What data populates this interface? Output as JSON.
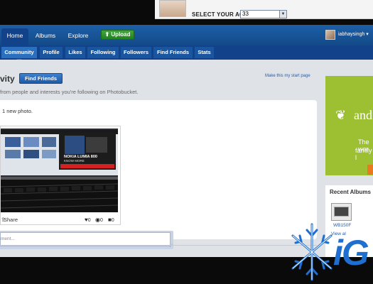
{
  "age_prompt": {
    "label": "SELECT YOUR AGE:",
    "value": "33"
  },
  "main_nav": {
    "tabs": [
      "Home",
      "Albums",
      "Explore"
    ],
    "upload_label": "Upload",
    "username": "iabhaysingh ▾"
  },
  "sub_nav": {
    "tabs": [
      "Community",
      "Profile",
      "Likes",
      "Following",
      "Followers",
      "Find Friends",
      "Stats"
    ],
    "active": "Community"
  },
  "page": {
    "heading": "vity",
    "find_friends_label": "Find Friends",
    "start_page_link": "Make this my start page",
    "subheading": "from people and interests you're following on Photobucket."
  },
  "feed": {
    "summary": "1 new photo.",
    "photo_overlay": {
      "title": "NOKIA LUMIA 800",
      "tagline": "KNOW MORE"
    },
    "share_label": "Share",
    "likes": "0",
    "views": "0",
    "comments": "0",
    "comment_placeholder": "ment..."
  },
  "ad": {
    "brand": "and",
    "line1": "The wor",
    "line2": "family l",
    "color": "#9dc033"
  },
  "recent_albums": {
    "title": "Recent Albums",
    "album_name": "WB150F",
    "link": "View al",
    "label": "WB"
  },
  "watermark": {
    "text": "iG"
  },
  "colors": {
    "nav_blue": "#1d5fa8",
    "subnav_blue": "#12428a",
    "upload_green": "#3fa83a",
    "link_blue": "#2a5aa5"
  }
}
